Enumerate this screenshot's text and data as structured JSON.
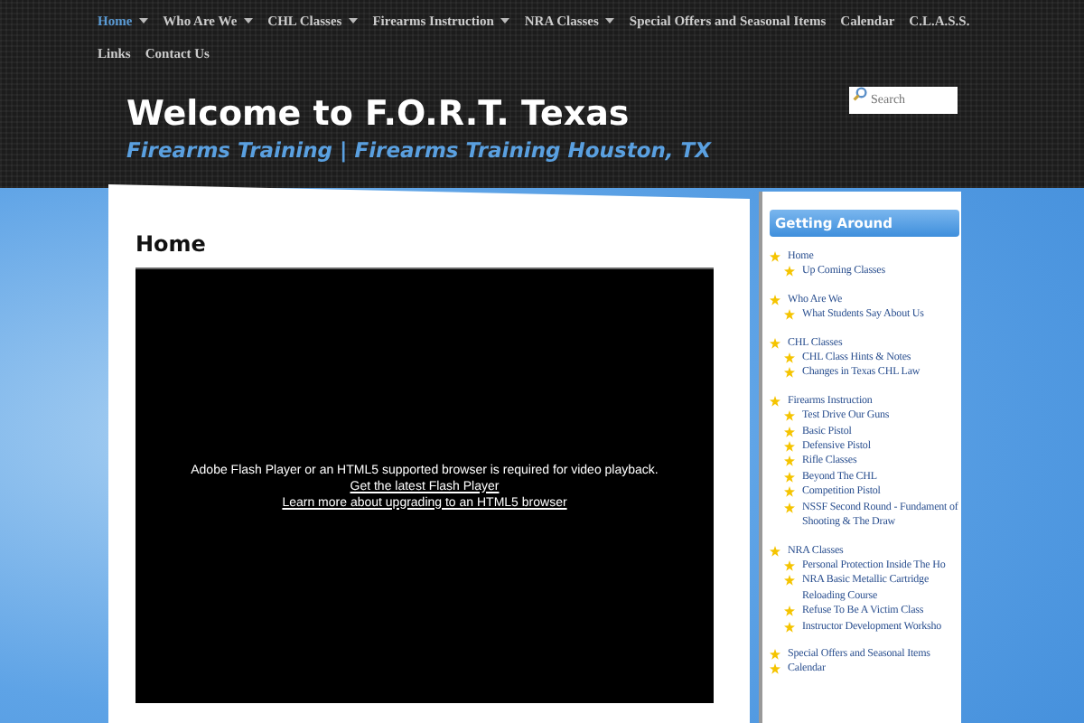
{
  "nav": [
    {
      "label": "Home",
      "selected": true,
      "dropdown": true
    },
    {
      "label": "Who Are We",
      "selected": false,
      "dropdown": true
    },
    {
      "label": "CHL Classes",
      "selected": false,
      "dropdown": true
    },
    {
      "label": "Firearms Instruction",
      "selected": false,
      "dropdown": true
    },
    {
      "label": "NRA Classes",
      "selected": false,
      "dropdown": true
    },
    {
      "label": "Special Offers and Seasonal Items",
      "selected": false,
      "dropdown": false
    },
    {
      "label": "Calendar",
      "selected": false,
      "dropdown": false
    },
    {
      "label": "C.L.A.S.S.",
      "selected": false,
      "dropdown": false
    },
    {
      "label": "Links",
      "selected": false,
      "dropdown": false
    },
    {
      "label": "Contact Us",
      "selected": false,
      "dropdown": false
    }
  ],
  "site": {
    "title": "Welcome to F.O.R.T. Texas",
    "tagline": "Firearms Training | Firearms Training Houston, TX"
  },
  "search": {
    "placeholder": "Search"
  },
  "page": {
    "heading": "Home",
    "video": {
      "message": "Adobe Flash Player or an HTML5 supported browser is required for video playback.",
      "links": [
        "Get the latest Flash Player",
        "Learn more about upgrading to an HTML5 browser"
      ]
    }
  },
  "sidebar": {
    "title": "Getting Around",
    "items": [
      {
        "label": "Home",
        "children": [
          {
            "label": "Up Coming Classes"
          }
        ]
      },
      {
        "label": "Who Are We",
        "children": [
          {
            "label": "What Students Say About Us"
          }
        ]
      },
      {
        "label": "CHL Classes",
        "children": [
          {
            "label": "CHL Class Hints & Notes"
          },
          {
            "label": "Changes in Texas CHL Law"
          }
        ]
      },
      {
        "label": "Firearms Instruction",
        "children": [
          {
            "label": "Test Drive Our Guns"
          },
          {
            "label": "Basic Pistol"
          },
          {
            "label": "Defensive Pistol"
          },
          {
            "label": "Rifle Classes"
          },
          {
            "label": "Beyond The CHL"
          },
          {
            "label": "Competition Pistol"
          },
          {
            "label": "NSSF Second Round - Fundament of Shooting & The Draw"
          }
        ]
      },
      {
        "label": "NRA Classes",
        "children": [
          {
            "label": "Personal Protection Inside The Ho"
          },
          {
            "label": "NRA Basic Metallic Cartridge Reloading Course"
          },
          {
            "label": "Refuse To Be A Victim Class"
          },
          {
            "label": "Instructor Development Worksho"
          }
        ]
      },
      {
        "label": "Special Offers and Seasonal Items"
      },
      {
        "label": "Calendar"
      }
    ]
  }
}
